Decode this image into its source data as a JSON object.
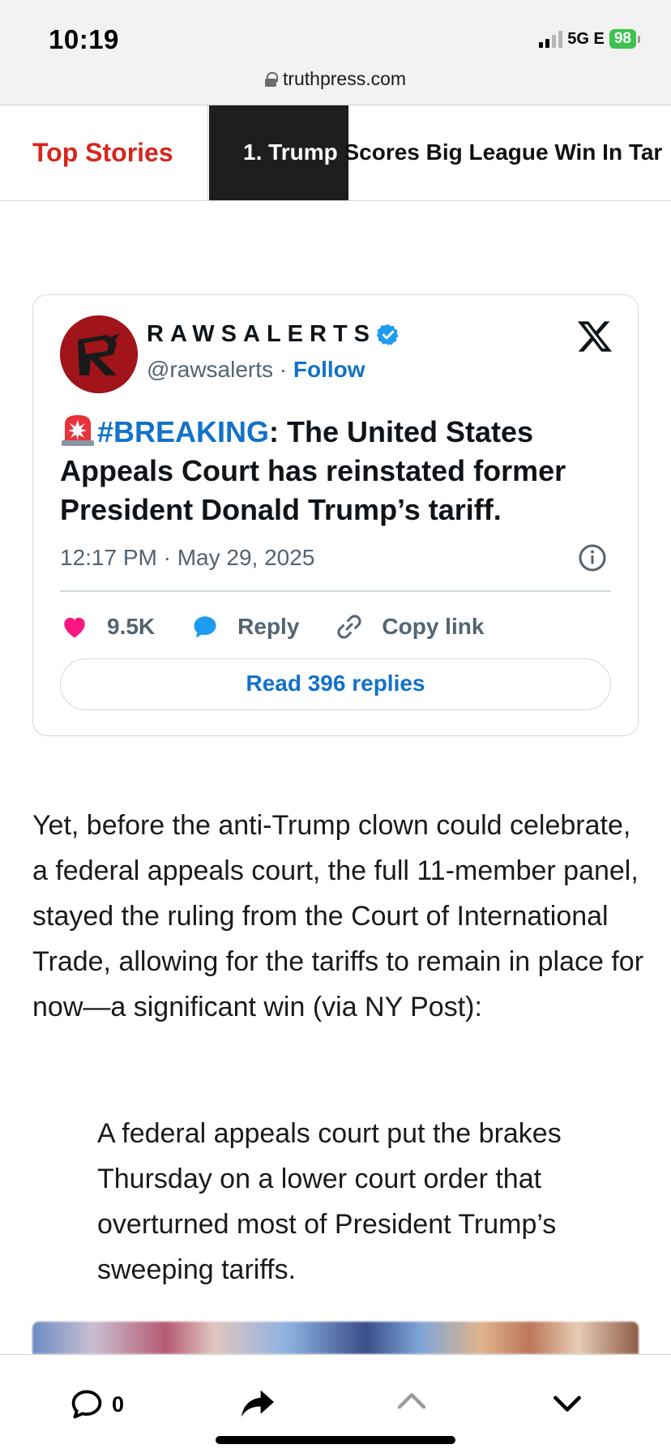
{
  "status_bar": {
    "time": "10:19",
    "network": "5G E",
    "battery": "98"
  },
  "browser": {
    "url": "truthpress.com"
  },
  "ticker": {
    "label": "Top Stories",
    "headline_dark_part": "1. Trump ",
    "headline_rest": "Scores Big League Win In Tar"
  },
  "tweet": {
    "display_name": "RAWSALERTS",
    "handle": "@rawsalerts",
    "separator": " · ",
    "follow_label": "Follow",
    "hashtag": "#BREAKING",
    "body": ": The United States Appeals Court has reinstated former President Donald Trump’s tariff.",
    "timestamp": "12:17 PM · May 29, 2025",
    "likes": "9.5K",
    "reply_label": "Reply",
    "copy_link_label": "Copy link",
    "read_replies_label": "Read 396 replies",
    "colors": {
      "accent_blue": "#1172c9",
      "heart": "#f91880",
      "avatar_bg": "#a0141a"
    }
  },
  "article": {
    "paragraph": "Yet, before the anti-Trump clown could celebrate, a federal appeals court, the full 11-member panel, stayed the ruling from the Court of International Trade, allowing for the tariffs to remain in place for now—a significant win (via NY Post):",
    "blockquote": "A federal appeals court put the brakes Thursday on a lower court order that overturned most of President Trump’s sweeping tariffs."
  },
  "toolbar": {
    "comment_count": "0",
    "icons": [
      "comment-icon",
      "share-icon",
      "chevron-up-icon",
      "chevron-down-icon"
    ]
  }
}
